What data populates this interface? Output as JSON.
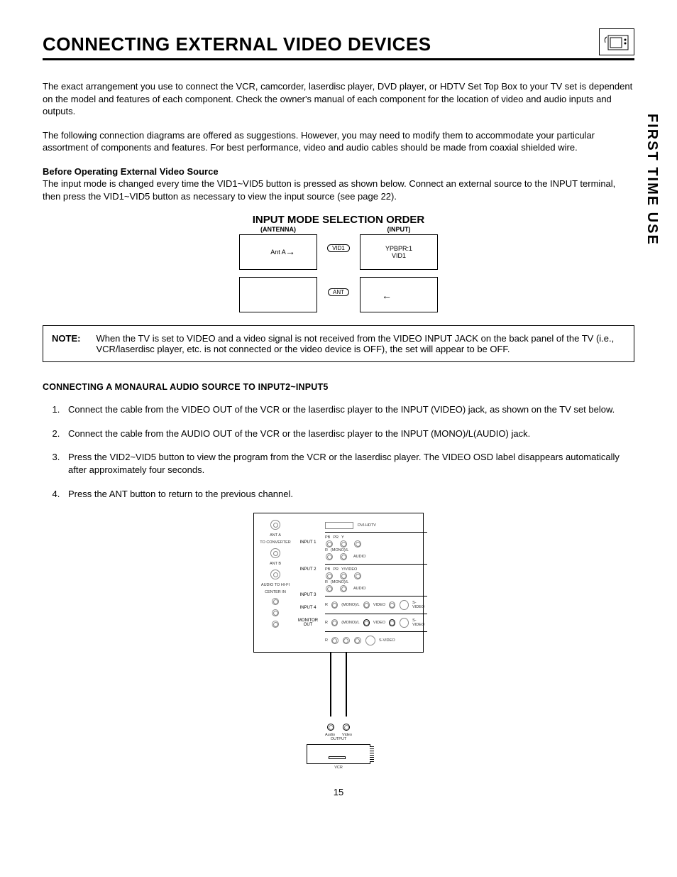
{
  "page_number": "15",
  "side_tab": "FIRST TIME USE",
  "title": "CONNECTING EXTERNAL VIDEO DEVICES",
  "intro_p1": "The exact arrangement you use to connect the VCR, camcorder, laserdisc player, DVD player, or HDTV Set Top Box to your TV set is dependent on the model and features of each component.  Check the owner's manual of each component for the location of video and audio inputs and outputs.",
  "intro_p2": "The following connection diagrams are offered as suggestions.  However, you may need to modify them to accommodate your particular assortment of components and features.  For best performance, video and audio cables should be made from coaxial shielded wire.",
  "before_heading": "Before Operating External Video Source",
  "before_body": "The input mode is changed every time the VID1~VID5 button is pressed as shown below.  Connect an external source to the INPUT terminal, then press the VID1~VID5 button as necessary to view the input source (see page 22).",
  "diagram1": {
    "title": "INPUT MODE SELECTION ORDER",
    "left_head": "(ANTENNA)",
    "right_head": "(INPUT)",
    "left_box": "Ant A",
    "right_box_l1": "YPBPR:1",
    "right_box_l2": "VID1",
    "pill_top": "VID1",
    "pill_bottom": "ANT"
  },
  "note": {
    "label": "NOTE:",
    "text": "When the TV is set to VIDEO and a video signal is not received from the VIDEO INPUT JACK on the back panel of the TV (i.e., VCR/laserdisc player, etc. is not connected or the video device is OFF), the set will appear to be OFF."
  },
  "section2_heading": "CONNECTING A MONAURAL AUDIO SOURCE TO INPUT2~INPUT5",
  "steps": [
    "Connect the cable from the VIDEO OUT of the VCR or the laserdisc player to the INPUT (VIDEO) jack, as shown on the TV set below.",
    "Connect the cable from the AUDIO OUT of the VCR or the laserdisc player to the INPUT (MONO)/L(AUDIO) jack.",
    "Press the VID2~VID5 button to view the program from the VCR or the laserdisc player.  The VIDEO OSD label disappears automatically after approximately four seconds.",
    "Press the ANT button to return to the previous channel."
  ],
  "diagram2": {
    "ant_a": "ANT A",
    "to_converter": "TO CONVERTER",
    "ant_b": "ANT B",
    "audio_hifi": "AUDIO TO HI-FI",
    "center_in": "CENTER IN",
    "input1": "INPUT 1",
    "input2": "INPUT 2",
    "input3": "INPUT 3",
    "input4": "INPUT 4",
    "monitor_out": "MONITOR OUT",
    "dvi": "DVI-HDTV",
    "pb": "PB",
    "pr": "PR",
    "y": "Y",
    "r": "R",
    "mono_l": "(MONO)/L",
    "audio": "AUDIO",
    "yvideo": "Y/VIDEO",
    "video": "VIDEO",
    "svideo": "S-VIDEO"
  },
  "vcr": {
    "audio": "Audio",
    "video": "Video",
    "output": "OUTPUT",
    "label": "VCR"
  }
}
